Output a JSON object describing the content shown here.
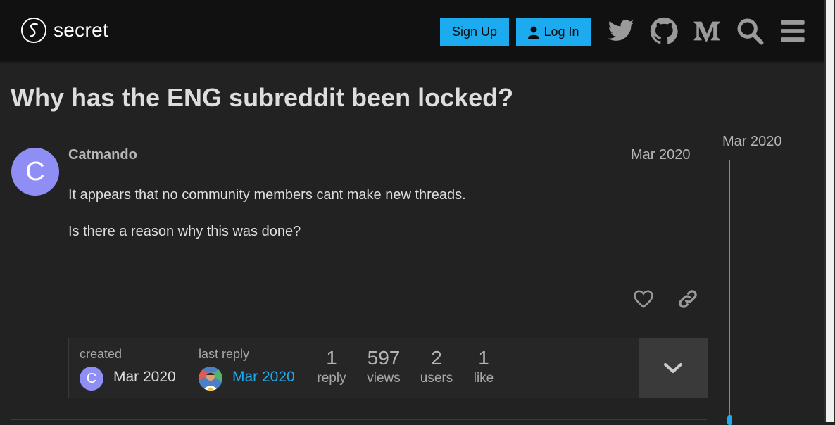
{
  "header": {
    "logo_text": "secret",
    "signup_label": "Sign Up",
    "login_label": "Log In"
  },
  "topic": {
    "title": "Why has the ENG subreddit been locked?"
  },
  "post": {
    "avatar_letter": "C",
    "username": "Catmando",
    "date": "Mar 2020",
    "paragraphs": [
      "It appears that no community members cant make new threads.",
      "Is there a reason why this was done?"
    ]
  },
  "meta": {
    "created_label": "created",
    "created_avatar_letter": "C",
    "created_date": "Mar 2020",
    "last_reply_label": "last reply",
    "last_reply_date": "Mar 2020",
    "stats": [
      {
        "num": "1",
        "label": "reply"
      },
      {
        "num": "597",
        "label": "views"
      },
      {
        "num": "2",
        "label": "users"
      },
      {
        "num": "1",
        "label": "like"
      }
    ]
  },
  "timeline": {
    "date": "Mar 2020"
  },
  "colors": {
    "accent": "#1dabf0",
    "avatar": "#8e8ef5",
    "header_bg": "#111111",
    "page_bg": "#222222"
  },
  "icons": [
    "secret-logo-icon",
    "user-icon",
    "twitter-icon",
    "github-icon",
    "medium-icon",
    "search-icon",
    "hamburger-menu-icon",
    "heart-icon",
    "link-icon",
    "chevron-down-icon"
  ]
}
